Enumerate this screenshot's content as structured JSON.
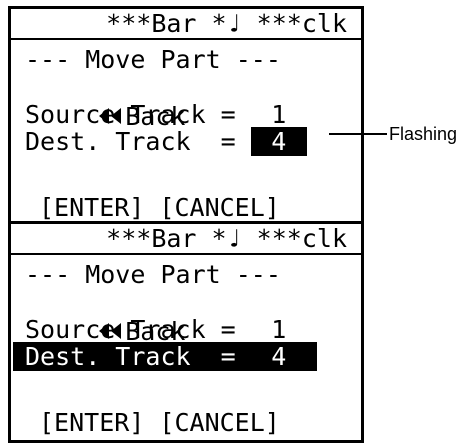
{
  "status_bar": "***Bar *♩ ***clk",
  "menu": {
    "title": "--- Move Part ---",
    "back_label": "Back",
    "source_label": "Source Track =",
    "source_value": "1",
    "dest_label": "Dest. Track  =",
    "dest_value": "4",
    "buttons": "[ENTER] [CANCEL]"
  },
  "annotation": {
    "flashing": "Flashing"
  }
}
